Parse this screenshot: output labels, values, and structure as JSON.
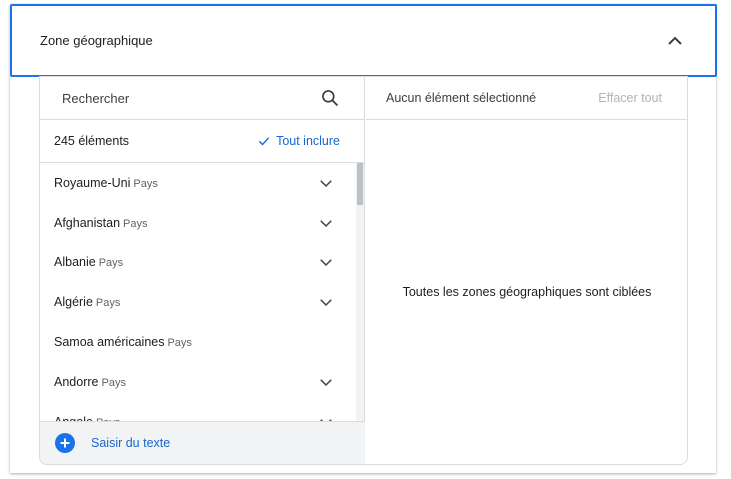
{
  "header": {
    "title": "Zone géographique",
    "collapse_icon": "chevron-up-icon"
  },
  "search": {
    "placeholder": "Rechercher",
    "value": "",
    "icon": "search-icon"
  },
  "list": {
    "count_label": "245 éléments",
    "include_all_label": "Tout inclure",
    "items": [
      {
        "name": "Royaume-Uni",
        "type": "Pays",
        "expandable": true
      },
      {
        "name": "Afghanistan",
        "type": "Pays",
        "expandable": true
      },
      {
        "name": "Albanie",
        "type": "Pays",
        "expandable": true
      },
      {
        "name": "Algérie",
        "type": "Pays",
        "expandable": true
      },
      {
        "name": "Samoa américaines",
        "type": "Pays",
        "expandable": false
      },
      {
        "name": "Andorre",
        "type": "Pays",
        "expandable": true
      },
      {
        "name": "Angola",
        "type": "Pays",
        "expandable": true
      }
    ]
  },
  "footer": {
    "label": "Saisir du texte",
    "icon": "add-circle-icon"
  },
  "selection": {
    "label": "Aucun élément sélectionné",
    "clear_label": "Effacer tout",
    "empty_message": "Toutes les zones géographiques sont ciblées"
  },
  "colors": {
    "accent": "#1a73e8",
    "link": "#1967d2",
    "border": "#dadce0",
    "footer_bg": "#f1f3f4"
  }
}
